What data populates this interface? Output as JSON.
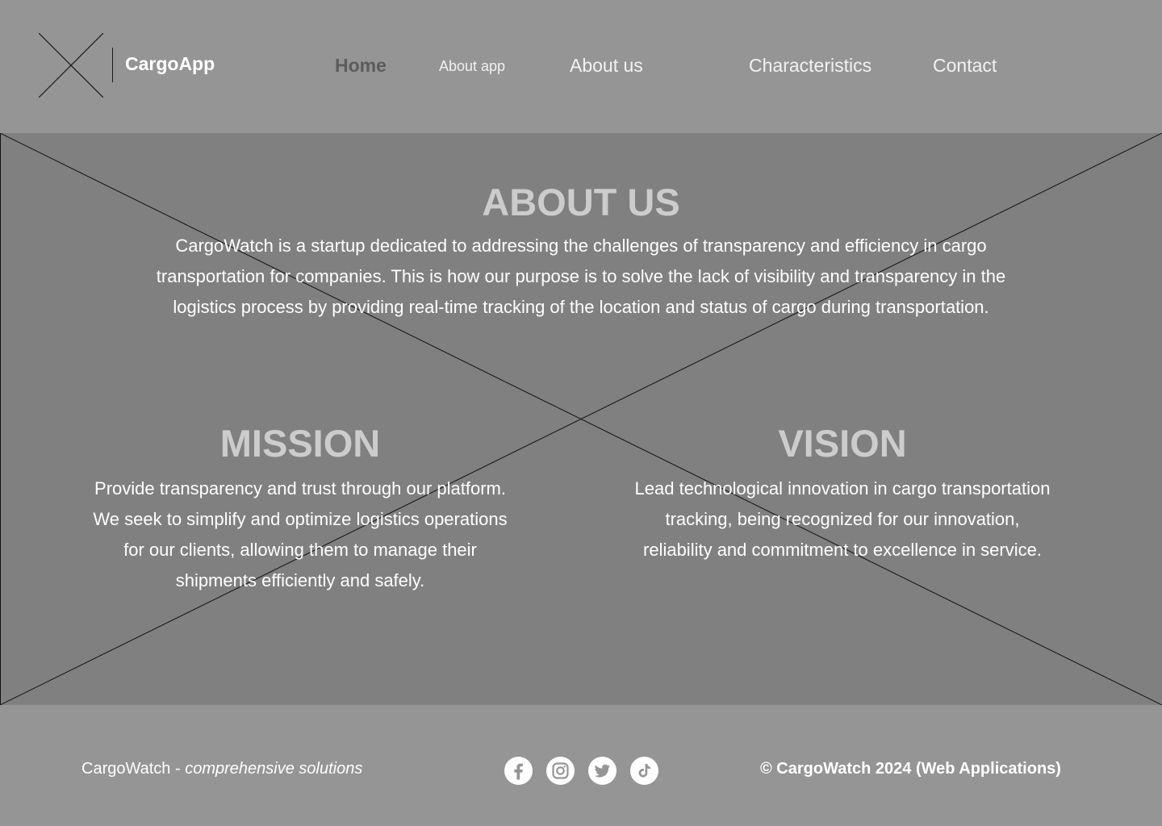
{
  "header": {
    "logo_icon": "image-placeholder-icon",
    "brand": "CargoApp",
    "nav": [
      {
        "label": "Home",
        "active": true
      },
      {
        "label": "About app",
        "active": false
      },
      {
        "label": "About us",
        "active": false
      },
      {
        "label": "Characteristics",
        "active": false
      },
      {
        "label": "Contact",
        "active": false
      }
    ]
  },
  "main": {
    "background_icon": "image-placeholder-icon",
    "about": {
      "title": "ABOUT US",
      "text": "CargoWatch is a startup dedicated to addressing the challenges of transparency and efficiency in cargo transportation for companies. This is how our purpose is to solve the lack of visibility and transparency in the logistics process by providing real-time tracking of the location and status of cargo during transportation."
    },
    "mission": {
      "title": "MISSION",
      "text": "Provide transparency and trust through our platform. We seek to simplify and optimize logistics operations for our clients, allowing them to manage their shipments efficiently and safely."
    },
    "vision": {
      "title": "VISION",
      "text": "Lead technological innovation in cargo transportation tracking, being recognized for our innovation, reliability and commitment to excellence in service."
    }
  },
  "footer": {
    "brand_name": "CargoWatch",
    "brand_separator": " - ",
    "tagline": "comprehensive solutions",
    "socials": [
      "facebook-icon",
      "instagram-icon",
      "twitter-icon",
      "tiktok-icon"
    ],
    "copyright": "© CargoWatch 2024 (Web Applications)"
  },
  "colors": {
    "header_bg": "#959595",
    "hero_bg": "#808080",
    "heading": "#cccccc",
    "text": "#ffffff",
    "active_nav": "#5c5c5c"
  }
}
